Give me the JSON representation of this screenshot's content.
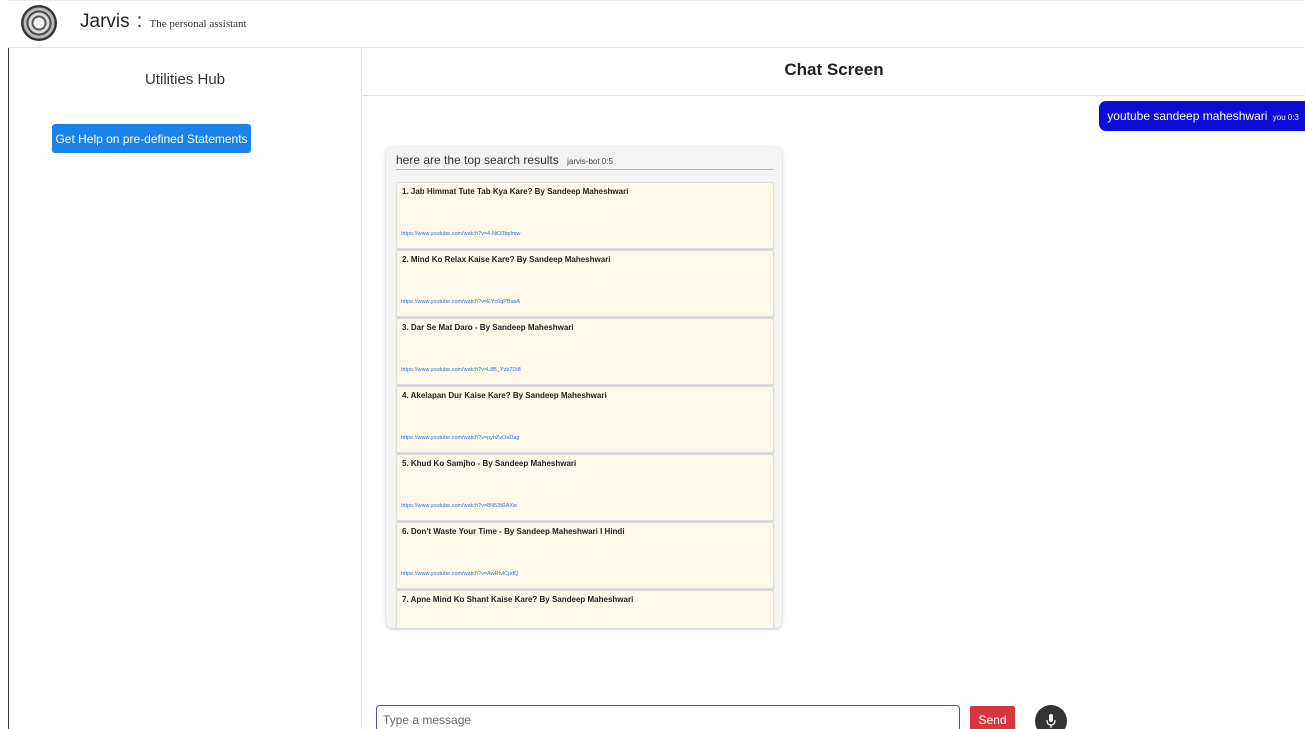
{
  "header": {
    "app_name": "Jarvis",
    "separator": ":",
    "subtitle": "The personal assistant"
  },
  "sidebar": {
    "title": "Utilities Hub",
    "help_button": "Get Help on pre-defined Statements"
  },
  "chat": {
    "title": "Chat Screen",
    "user_message": {
      "text": "youtube sandeep maheshwari",
      "meta": "you 0:3"
    },
    "bot_message": {
      "text": "here are the top search results",
      "meta": "jarvis-bot 0:5"
    },
    "results": [
      {
        "title": "1. Jab Himmat Tute Tab Kya Kare? By Sandeep Maheshwari",
        "url": "https://www.youtube.com/watch?v=4-NiO3bplmw"
      },
      {
        "title": "2. Mind Ko Relax Kaise Kare? By Sandeep Maheshwari",
        "url": "https://www.youtube.com/watch?v=EYc6qPBasA"
      },
      {
        "title": "3. Dar Se Mat Daro - By Sandeep Maheshwari",
        "url": "https://www.youtube.com/watch?v=L8B_Yzb7Di8"
      },
      {
        "title": "4. Akelapan Dur Kaise Kare? By Sandeep Maheshwari",
        "url": "https://www.youtube.com/watch?v=pyhZvOaDag"
      },
      {
        "title": "5. Khud Ko Samjho - By Sandeep Maheshwari",
        "url": "https://www.youtube.com/watch?v=8N53tRAXw"
      },
      {
        "title": "6. Don't Waste Your Time - By Sandeep Maheshwari I Hindi",
        "url": "https://www.youtube.com/watch?v=AwRtvlCpdQ"
      },
      {
        "title": "7. Apne Mind Ko Shant Kaise Kare? By Sandeep Maheshwari",
        "url": ""
      }
    ]
  },
  "composer": {
    "placeholder": "Type a message",
    "send_label": "Send",
    "mic_icon": "microphone-icon"
  },
  "colors": {
    "help_button": "#1a82e8",
    "user_bubble": "#0d0dd9",
    "send_button": "#d6373c",
    "result_card": "#fcf8ea"
  }
}
